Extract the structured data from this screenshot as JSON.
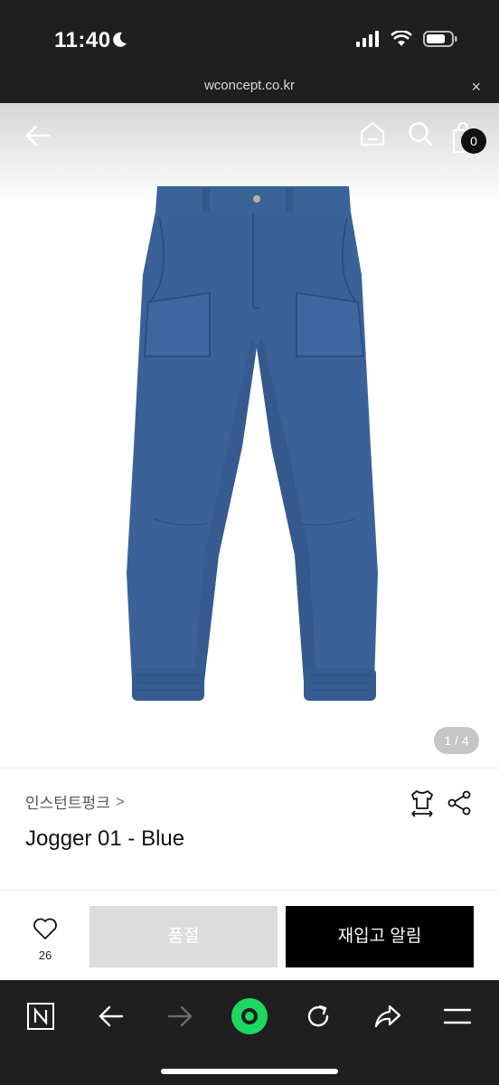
{
  "status_bar": {
    "time": "11:40"
  },
  "url_bar": {
    "url": "wconcept.co.kr",
    "close_symbol": "×"
  },
  "header": {
    "cart_count": "0"
  },
  "gallery": {
    "pager": "1 / 4"
  },
  "product": {
    "brand": "인스턴트펑크",
    "brand_chevron": ">",
    "title": "Jogger 01 - Blue"
  },
  "actions": {
    "like_count": "26",
    "soldout_label": "품절",
    "notify_label": "재입고 알림"
  },
  "colors": {
    "denim": "#3b6298",
    "bottom_bar": "#1f1f1f",
    "accent_green": "#1ed760"
  }
}
